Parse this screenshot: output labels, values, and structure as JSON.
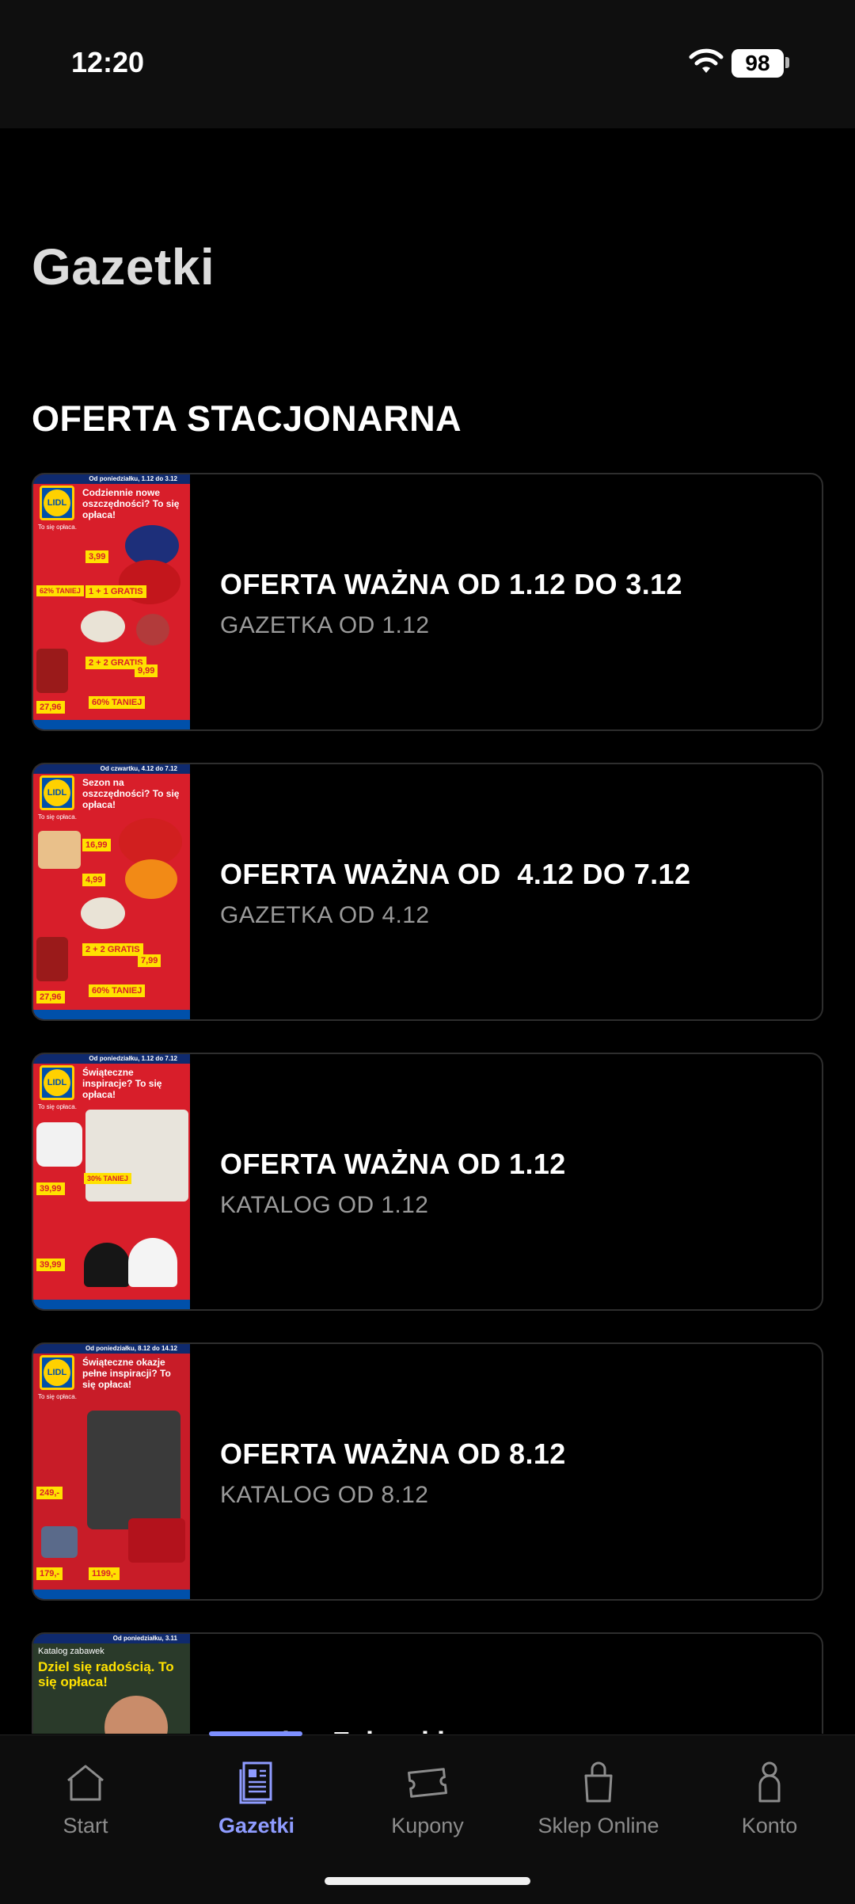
{
  "status_bar": {
    "time": "12:20",
    "battery": "98"
  },
  "page_title": "Gazetki",
  "section_title": "OFERTA STACJONARNA",
  "cards": [
    {
      "title": "OFERTA WAŻNA OD 1.12 DO 3.12",
      "subtitle": "GAZETKA OD 1.12",
      "thumb": {
        "date": "Od poniedziałku, 1.12 do 3.12",
        "headline": "Codziennie nowe oszczędności? To się opłaca!",
        "tag": "To się opłaca.",
        "prices": [
          "3,99",
          "1 + 1 GRATIS",
          "62% TANIEJ",
          "2 + 2 GRATIS",
          "9,99",
          "60% TANIEJ",
          "27,96"
        ]
      }
    },
    {
      "title": "OFERTA WAŻNA OD  4.12 DO 7.12",
      "subtitle": "GAZETKA OD 4.12",
      "thumb": {
        "date": "Od czwartku, 4.12 do 7.12",
        "headline": "Sezon na oszczędności? To się opłaca!",
        "tag": "To się opłaca.",
        "prices": [
          "16,99",
          "4,99",
          "2 + 2 GRATIS",
          "7,99",
          "60% TANIEJ",
          "27,96"
        ]
      }
    },
    {
      "title": "OFERTA WAŻNA OD 1.12",
      "subtitle": "KATALOG OD 1.12",
      "thumb": {
        "date": "Od poniedziałku, 1.12 do 7.12",
        "headline": "Świąteczne inspiracje? To się opłaca!",
        "tag": "To się opłaca.",
        "prices": [
          "39,99",
          "30% TANIEJ",
          "39,99"
        ]
      }
    },
    {
      "title": "OFERTA WAŻNA OD 8.12",
      "subtitle": "KATALOG OD 8.12",
      "thumb": {
        "date": "Od poniedziałku, 8.12 do 14.12",
        "headline": "Świąteczne okazje pełne inspiracji? To się opłaca!",
        "tag": "To się opłaca.",
        "prices": [
          "249,-",
          "179,-",
          "1199,-"
        ]
      }
    },
    {
      "title": "Katalog Zabawki",
      "subtitle": "",
      "thumb": {
        "date": "Od poniedziałku, 3.11",
        "headline": "Dziel się radością. To się opłaca!",
        "tag": "Katalog zabawek",
        "prices": []
      }
    }
  ],
  "bottom_nav": [
    {
      "label": "Start",
      "icon": "home-icon",
      "active": false
    },
    {
      "label": "Gazetki",
      "icon": "leaflet-icon",
      "active": true
    },
    {
      "label": "Kupony",
      "icon": "coupon-icon",
      "active": false
    },
    {
      "label": "Sklep Online",
      "icon": "shopping-bag-icon",
      "active": false
    },
    {
      "label": "Konto",
      "icon": "account-icon",
      "active": false
    }
  ],
  "colors": {
    "background": "#000000",
    "card_border": "#2e2e2e",
    "subtitle": "#9a9a9a",
    "accent": "#8f9cff",
    "lidl_red": "#d81e2a",
    "lidl_blue": "#0050aa",
    "lidl_yellow": "#ffd100"
  }
}
